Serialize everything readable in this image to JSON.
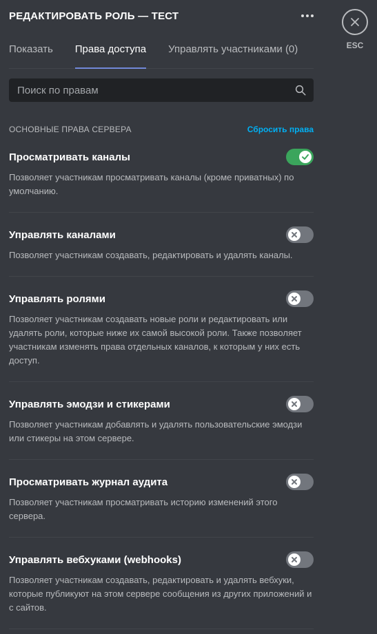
{
  "header": {
    "title": "РЕДАКТИРОВАТЬ РОЛЬ — ТЕСТ",
    "more_icon": "more-horizontal-icon"
  },
  "tabs": [
    {
      "label": "Показать",
      "active": false
    },
    {
      "label": "Права доступа",
      "active": true
    },
    {
      "label": "Управлять участниками (0)",
      "active": false
    }
  ],
  "search": {
    "placeholder": "Поиск по правам",
    "value": "",
    "icon": "search-icon"
  },
  "section": {
    "title": "Основные права сервера",
    "reset_label": "Сбросить права"
  },
  "permissions": [
    {
      "name": "Просматривать каналы",
      "description": "Позволяет участникам просматривать каналы (кроме приватных) по умолчанию.",
      "enabled": true
    },
    {
      "name": "Управлять каналами",
      "description": "Позволяет участникам создавать, редактировать и удалять каналы.",
      "enabled": false
    },
    {
      "name": "Управлять ролями",
      "description": "Позволяет участникам создавать новые роли и редактировать или удалять роли, которые ниже их самой высокой роли. Также позволяет участникам изменять права отдельных каналов, к которым у них есть доступ.",
      "enabled": false
    },
    {
      "name": "Управлять эмодзи и стикерами",
      "description": "Позволяет участникам добавлять и удалять пользовательские эмодзи или стикеры на этом сервере.",
      "enabled": false
    },
    {
      "name": "Просматривать журнал аудита",
      "description": "Позволяет участникам просматривать историю изменений этого сервера.",
      "enabled": false
    },
    {
      "name": "Управлять вебхуками (webhooks)",
      "description": "Позволяет участникам создавать, редактировать и удалять вебхуки, которые публикуют на этом сервере сообщения из других приложений и с сайтов.",
      "enabled": false
    }
  ],
  "close": {
    "label": "ESC",
    "icon": "close-icon"
  },
  "colors": {
    "background": "#36393f",
    "toggle_on": "#3ba55c",
    "toggle_off": "#72767d",
    "link": "#00b0f4",
    "tab_underline": "#7289da"
  }
}
